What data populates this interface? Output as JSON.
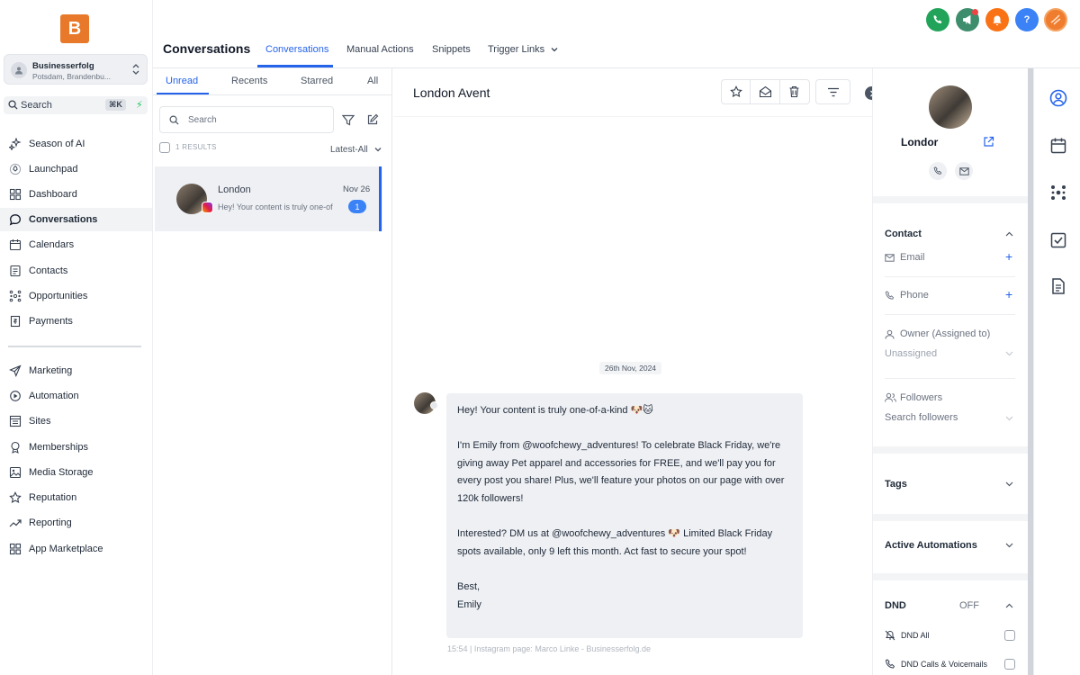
{
  "brand": {
    "logo_letter": "B"
  },
  "account": {
    "name": "Businesserfolg",
    "location": "Potsdam, Brandenbu..."
  },
  "search": {
    "label": "Search",
    "shortcut": "⌘K"
  },
  "nav": {
    "primary": [
      {
        "label": "Season of AI",
        "icon": "sparkles-icon"
      },
      {
        "label": "Launchpad",
        "icon": "rocket-icon"
      },
      {
        "label": "Dashboard",
        "icon": "grid-icon"
      },
      {
        "label": "Conversations",
        "icon": "chat-bubble-icon",
        "active": true
      },
      {
        "label": "Calendars",
        "icon": "calendar-icon"
      },
      {
        "label": "Contacts",
        "icon": "contacts-icon"
      },
      {
        "label": "Opportunities",
        "icon": "network-icon"
      },
      {
        "label": "Payments",
        "icon": "receipt-icon"
      }
    ],
    "secondary": [
      {
        "label": "Marketing",
        "icon": "send-icon"
      },
      {
        "label": "Automation",
        "icon": "automation-icon"
      },
      {
        "label": "Sites",
        "icon": "sites-icon"
      },
      {
        "label": "Memberships",
        "icon": "award-icon"
      },
      {
        "label": "Media Storage",
        "icon": "image-icon"
      },
      {
        "label": "Reputation",
        "icon": "star-icon"
      },
      {
        "label": "Reporting",
        "icon": "trend-icon"
      },
      {
        "label": "App Marketplace",
        "icon": "apps-icon"
      }
    ]
  },
  "header": {
    "title": "Conversations",
    "tabs": [
      {
        "label": "Conversations",
        "active": true
      },
      {
        "label": "Manual Actions"
      },
      {
        "label": "Snippets"
      },
      {
        "label": "Trigger Links"
      }
    ]
  },
  "top_icons": [
    {
      "icon": "phone-icon",
      "color": "#22a35a"
    },
    {
      "icon": "megaphone-icon",
      "color": "#3e8e6e"
    },
    {
      "icon": "bell-icon",
      "color": "#f97316"
    },
    {
      "icon": "help-icon",
      "color": "#3b82f6"
    },
    {
      "icon": "user-avatar-icon",
      "color": "#f07c2e"
    }
  ],
  "conv_list": {
    "tabs": [
      "Unread",
      "Recents",
      "Starred",
      "All"
    ],
    "search_placeholder": "Search",
    "results": "1 RESULTS",
    "sort": "Latest-All",
    "items": [
      {
        "name": "London",
        "date": "Nov 26",
        "preview": "Hey! Your content is truly one-of-a-kind",
        "unread": "1"
      }
    ]
  },
  "chat": {
    "title": "London Avent",
    "date_separator": "26th Nov, 2024",
    "message": {
      "lines": [
        "Hey! Your content is truly one-of-a-kind 🐶🐱",
        "I'm Emily from @woofchewy_adventures! To celebrate Black Friday, we're giving away Pet apparel and accessories for FREE, and we'll pay you for every post you share! Plus, we'll feature your photos on our page with over 120k followers!",
        "Interested? DM us at @woofchewy_adventures 🐶 Limited Black Friday spots available, only 9 left this month. Act fast to secure your spot!",
        "Best,",
        "Emily"
      ],
      "meta": "15:54 | Instagram page: Marco Linke - Businesserfolg.de"
    }
  },
  "contact": {
    "name": "Londor",
    "sections": {
      "contact": "Contact",
      "email": "Email",
      "phone": "Phone",
      "owner": "Owner (Assigned to)",
      "owner_value": "Unassigned",
      "followers": "Followers",
      "followers_placeholder": "Search followers",
      "tags": "Tags",
      "active_automations": "Active Automations",
      "dnd": "DND",
      "dnd_state": "OFF",
      "dnd_all": "DND All",
      "dnd_calls": "DND Calls & Voicemails"
    }
  },
  "colors": {
    "accent": "#2563eb",
    "brand": "#e8792b"
  }
}
